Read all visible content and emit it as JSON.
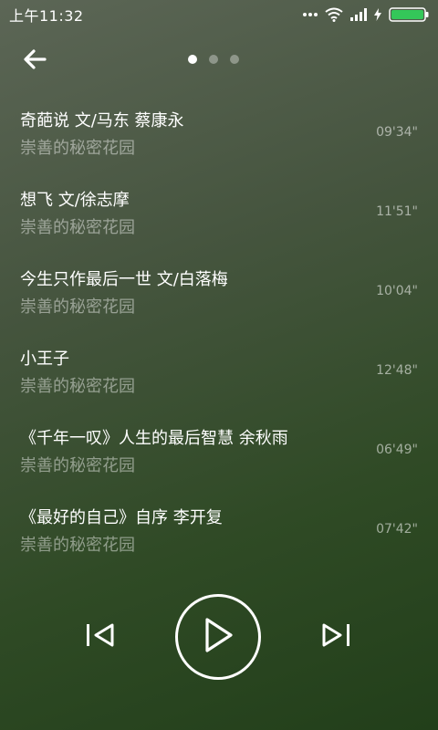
{
  "status_bar": {
    "time": "上午11:32",
    "icons": [
      "more-dots-icon",
      "wifi-icon",
      "signal-icon",
      "charging-icon",
      "battery-icon"
    ],
    "battery_color": "#34c759"
  },
  "header": {
    "back_icon": "arrow-left-icon",
    "pages": 3,
    "active_page": 1
  },
  "tracks": [
    {
      "title": "奇葩说 文/马东 蔡康永",
      "artist": "崇善的秘密花园",
      "duration": "09'34\""
    },
    {
      "title": "想飞 文/徐志摩",
      "artist": "崇善的秘密花园",
      "duration": "11'51\""
    },
    {
      "title": "今生只作最后一世 文/白落梅",
      "artist": "崇善的秘密花园",
      "duration": "10'04\""
    },
    {
      "title": "小王子",
      "artist": "崇善的秘密花园",
      "duration": "12'48\""
    },
    {
      "title": "《千年一叹》人生的最后智慧 余秋雨",
      "artist": "崇善的秘密花园",
      "duration": "06'49\""
    },
    {
      "title": "《最好的自己》自序 李开复",
      "artist": "崇善的秘密花园",
      "duration": "07'42\""
    }
  ],
  "player": {
    "prev_icon": "skip-previous-icon",
    "play_icon": "play-icon",
    "next_icon": "skip-next-icon"
  }
}
